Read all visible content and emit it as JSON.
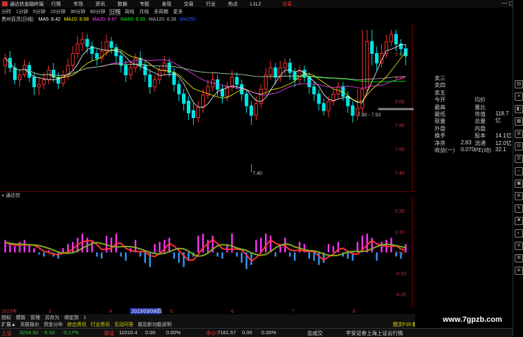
{
  "app": {
    "title": "通达信金融终端",
    "menu": [
      "行情",
      "市场",
      "资讯",
      "数据",
      "专题",
      "发现",
      "交易",
      "行业",
      "热点",
      "L1L2"
    ],
    "trade_label": "交易",
    "win_controls": "— ▢ ✕"
  },
  "periods": [
    {
      "label": "分时",
      "sel": false
    },
    {
      "label": "1分钟",
      "sel": false
    },
    {
      "label": "5分钟",
      "sel": false
    },
    {
      "label": "15分钟",
      "sel": false
    },
    {
      "label": "30分钟",
      "sel": false
    },
    {
      "label": "60分钟",
      "sel": false
    },
    {
      "label": "日线",
      "sel": true
    },
    {
      "label": "周线",
      "sel": false
    },
    {
      "label": "月线",
      "sel": false
    },
    {
      "label": "多周期",
      "sel": false
    },
    {
      "label": "更多",
      "sel": false
    }
  ],
  "ma_bar": {
    "stock": "贵州百灵(日线)",
    "items": [
      {
        "label": "MA5: 8.42",
        "color": "#ffffff"
      },
      {
        "label": "MA10: 8.58",
        "color": "#ffff00"
      },
      {
        "label": "MA20: 8.67",
        "color": "#ff44ff"
      },
      {
        "label": "MA60: 8.39",
        "color": "#00ff00"
      },
      {
        "label": "MA120: 8.28",
        "color": "#bbbbbb"
      },
      {
        "label": "MA250:",
        "color": "#3355ff"
      }
    ]
  },
  "price_axis": [
    "8.40",
    "8.20",
    "8.00",
    "7.80",
    "7.60",
    "7.40"
  ],
  "price_annotations": {
    "low": "7.40",
    "range": "7.90 - 7.93"
  },
  "ind_header": "通达信",
  "ind_axis": [
    "0.20",
    "0.10",
    "0.00",
    "-0.10",
    "-0.20"
  ],
  "date_axis": {
    "year": "2023年",
    "highlight": "2023/03/09/四",
    "months": [
      "3",
      "4",
      "5",
      "6",
      "7",
      "8"
    ]
  },
  "right_panel": {
    "rows": [
      {
        "l": "卖三",
        "v": "",
        "l2": "",
        "v2": ""
      },
      {
        "l": "卖四",
        "v": "",
        "l2": "",
        "v2": ""
      },
      {
        "l": "卖五",
        "v": "",
        "l2": "",
        "v2": ""
      },
      {
        "l": "今开",
        "v": "",
        "l2": "均价",
        "v2": ""
      },
      {
        "l": "最高",
        "v": "",
        "l2": "量比",
        "v2": ""
      },
      {
        "l": "最低",
        "v": "",
        "l2": "市值",
        "v2": "118.7亿"
      },
      {
        "l": "现量",
        "v": "",
        "l2": "总量",
        "v2": ""
      },
      {
        "l": "外盘",
        "v": "",
        "l2": "内盘",
        "v2": ""
      },
      {
        "l": "换手",
        "v": "",
        "l2": "股本",
        "v2": "14.1亿"
      },
      {
        "l": "净资",
        "v": "2.83",
        "l2": "流通",
        "v2": "12.0亿"
      },
      {
        "l": "收益(一)",
        "v": "0.070",
        "l2": "PE(动)",
        "v2": "32.1"
      }
    ]
  },
  "tabs_row1": [
    "指标",
    "模板",
    "管理",
    "另存为",
    "绑定到",
    "1"
  ],
  "tabs_row2": [
    {
      "label": "扩展▲",
      "y": false
    },
    {
      "label": "关联报价",
      "y": false
    },
    {
      "label": "资金分布",
      "y": false
    },
    {
      "label": "综合资讯",
      "y": true
    },
    {
      "label": "行业资讯",
      "y": true
    },
    {
      "label": "互动问答",
      "y": true
    },
    {
      "label": "普及新功能说明",
      "y": false
    }
  ],
  "tabs_right": "图文F10 新闻",
  "ticker": [
    {
      "name": "上证",
      "value": "3204.30",
      "chg": "-5.33",
      "pct": "-0.17%"
    },
    {
      "name": "深证",
      "value": "11010.4",
      "chg": "0.00",
      "pct": "0.00%"
    },
    {
      "name": "中小",
      "value": "7161.57",
      "chg": "0.00",
      "pct": "0.00%"
    }
  ],
  "ticker_extra": "总成交",
  "ticker_news": "平安证券上海上证云行情",
  "watermark": "www.7gpzb.com",
  "chart_data": {
    "type": "candlestick",
    "ylim": [
      7.3,
      8.6
    ],
    "ylabel": "",
    "candles": [
      [
        8.3,
        8.36,
        8.4,
        8.22
      ],
      [
        8.36,
        8.28,
        8.42,
        8.24
      ],
      [
        8.28,
        8.18,
        8.32,
        8.14
      ],
      [
        8.18,
        8.22,
        8.26,
        8.12
      ],
      [
        8.22,
        8.3,
        8.35,
        8.2
      ],
      [
        8.3,
        8.2,
        8.33,
        8.16
      ],
      [
        8.2,
        8.12,
        8.24,
        8.05
      ],
      [
        8.12,
        8.14,
        8.2,
        8.05
      ],
      [
        8.14,
        8.18,
        8.24,
        8.1
      ],
      [
        8.18,
        8.26,
        8.3,
        8.14
      ],
      [
        8.26,
        8.2,
        8.32,
        8.16
      ],
      [
        8.2,
        8.15,
        8.24,
        8.1
      ],
      [
        8.15,
        8.22,
        8.26,
        8.12
      ],
      [
        8.22,
        8.3,
        8.36,
        8.18
      ],
      [
        8.3,
        8.4,
        8.46,
        8.26
      ],
      [
        8.4,
        8.48,
        8.55,
        8.36
      ],
      [
        8.48,
        8.52,
        8.58,
        8.42
      ],
      [
        8.52,
        8.46,
        8.56,
        8.4
      ],
      [
        8.46,
        8.4,
        8.5,
        8.34
      ],
      [
        8.4,
        8.36,
        8.44,
        8.3
      ],
      [
        8.36,
        8.42,
        8.5,
        8.32
      ],
      [
        8.42,
        8.5,
        8.56,
        8.38
      ],
      [
        8.5,
        8.45,
        8.54,
        8.4
      ],
      [
        8.45,
        8.38,
        8.48,
        8.32
      ],
      [
        8.38,
        8.3,
        8.42,
        8.24
      ],
      [
        8.3,
        8.22,
        8.34,
        8.16
      ],
      [
        8.22,
        8.28,
        8.33,
        8.18
      ],
      [
        8.28,
        8.36,
        8.4,
        8.24
      ],
      [
        8.36,
        8.3,
        8.42,
        8.26
      ],
      [
        8.3,
        8.22,
        8.34,
        8.16
      ],
      [
        8.22,
        8.12,
        8.26,
        8.06
      ],
      [
        8.12,
        8.18,
        8.22,
        8.08
      ],
      [
        8.18,
        8.26,
        8.3,
        8.14
      ],
      [
        8.26,
        8.32,
        8.38,
        8.22
      ],
      [
        8.32,
        8.24,
        8.36,
        8.2
      ],
      [
        8.24,
        8.14,
        8.28,
        8.08
      ],
      [
        8.14,
        8.06,
        8.18,
        8.0
      ],
      [
        8.06,
        7.98,
        8.1,
        7.92
      ],
      [
        8.0,
        7.9,
        8.04,
        7.84
      ],
      [
        7.92,
        7.86,
        7.98,
        7.8
      ],
      [
        7.86,
        7.95,
        8.0,
        7.82
      ],
      [
        7.95,
        8.05,
        8.1,
        7.9
      ],
      [
        8.05,
        8.12,
        8.18,
        8.02
      ],
      [
        8.12,
        8.18,
        8.24,
        8.08
      ],
      [
        8.18,
        8.1,
        8.22,
        8.04
      ],
      [
        8.1,
        8.04,
        8.14,
        7.98
      ],
      [
        8.04,
        8.12,
        8.16,
        8.0
      ],
      [
        8.12,
        8.2,
        8.26,
        8.08
      ],
      [
        8.2,
        8.14,
        8.24,
        8.1
      ],
      [
        8.14,
        8.06,
        8.18,
        8.0
      ],
      [
        8.06,
        7.96,
        8.1,
        7.9
      ],
      [
        7.96,
        7.88,
        8.0,
        7.8
      ],
      [
        7.88,
        7.98,
        8.04,
        7.84
      ],
      [
        7.98,
        8.1,
        8.14,
        7.94
      ],
      [
        8.1,
        8.22,
        8.28,
        8.06
      ],
      [
        8.22,
        8.28,
        8.34,
        8.18
      ],
      [
        8.28,
        8.2,
        8.32,
        8.14
      ],
      [
        8.2,
        8.28,
        8.34,
        8.16
      ],
      [
        8.28,
        8.32,
        8.36,
        8.22
      ],
      [
        8.32,
        8.24,
        8.36,
        8.18
      ],
      [
        8.24,
        8.18,
        8.28,
        8.12
      ],
      [
        8.18,
        8.26,
        8.3,
        8.14
      ],
      [
        8.26,
        8.2,
        8.3,
        8.16
      ],
      [
        8.2,
        8.12,
        8.24,
        8.06
      ],
      [
        8.12,
        8.06,
        8.16,
        8.0
      ],
      [
        8.06,
        7.98,
        8.1,
        7.92
      ],
      [
        7.98,
        7.92,
        8.02,
        7.88
      ],
      [
        7.92,
        8.0,
        8.04,
        7.86
      ],
      [
        8.0,
        8.06,
        8.1,
        7.96
      ],
      [
        8.06,
        8.12,
        8.16,
        8.02
      ],
      [
        8.12,
        8.04,
        8.16,
        8.0
      ],
      [
        8.04,
        7.96,
        8.08,
        7.9
      ],
      [
        7.96,
        7.88,
        8.0,
        7.82
      ],
      [
        7.88,
        7.94,
        8.1,
        7.84
      ],
      [
        7.94,
        8.1,
        8.6,
        7.9
      ],
      [
        8.1,
        8.5,
        8.6,
        8.06
      ],
      [
        8.5,
        8.4,
        8.6,
        8.3
      ],
      [
        8.4,
        8.32,
        8.46,
        8.26
      ],
      [
        8.32,
        8.4,
        8.48,
        8.28
      ],
      [
        8.4,
        8.5,
        8.56,
        8.36
      ],
      [
        8.5,
        8.56,
        8.6,
        8.46
      ],
      [
        8.56,
        8.48,
        8.6,
        8.42
      ],
      [
        8.48,
        8.44,
        8.52,
        8.38
      ],
      [
        8.44,
        8.38,
        8.48,
        8.3
      ]
    ],
    "macd": [
      0.06,
      0.04,
      0.03,
      0.05,
      0.06,
      0.04,
      0.02,
      -0.01,
      -0.02,
      0.01,
      -0.02,
      -0.03,
      0.02,
      0.04,
      0.05,
      0.07,
      0.09,
      0.07,
      0.05,
      -0.02,
      -0.03,
      0.08,
      0.07,
      0.09,
      -0.02,
      -0.04,
      0.02,
      0.06,
      -0.02,
      -0.05,
      -0.07,
      0.04,
      0.05,
      0.06,
      0.07,
      -0.03,
      -0.05,
      -0.07,
      -0.04,
      -0.02,
      0.08,
      0.09,
      0.06,
      0.08,
      -0.02,
      -0.03,
      0.04,
      0.09,
      -0.02,
      -0.05,
      -0.08,
      -0.06,
      0.06,
      0.07,
      0.09,
      0.08,
      -0.02,
      0.03,
      0.07,
      -0.02,
      -0.04,
      0.05,
      0.04,
      -0.03,
      -0.04,
      -0.06,
      -0.05,
      0.04,
      0.03,
      0.05,
      -0.02,
      -0.03,
      -0.04,
      0.05,
      0.08,
      0.09,
      0.07,
      -0.04,
      0.05,
      0.06,
      0.07,
      -0.02,
      -0.03,
      0.04
    ]
  }
}
